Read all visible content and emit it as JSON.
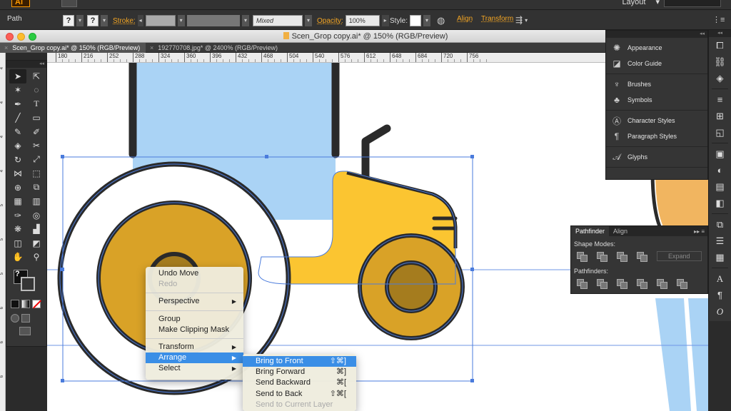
{
  "app": {
    "logo": "Ai",
    "workspace_label": "Layout"
  },
  "control_bar": {
    "selection_label": "Path",
    "stroke_label": "Stroke:",
    "brush_value": "Mixed",
    "opacity_label": "Opacity:",
    "opacity_value": "100%",
    "style_label": "Style:",
    "align_label": "Align",
    "transform_label": "Transform"
  },
  "window": {
    "title": "Scen_Grop copy.ai* @ 150% (RGB/Preview)"
  },
  "tabs": [
    {
      "label": "Scen_Grop copy.ai* @ 150% (RGB/Preview)",
      "active": true
    },
    {
      "label": "192770708.jpg* @ 2400% (RGB/Preview)",
      "active": false
    }
  ],
  "ruler_h": [
    "180",
    "216",
    "252",
    "288",
    "324",
    "360",
    "396",
    "432",
    "468",
    "504",
    "540",
    "576",
    "612",
    "648",
    "684",
    "720",
    "756"
  ],
  "ruler_v": [
    "4",
    "4",
    "4",
    "4",
    "5",
    "5",
    "5",
    "6",
    "6",
    "6"
  ],
  "context_menu": {
    "items": [
      {
        "label": "Undo Move",
        "enabled": true,
        "submenu": false
      },
      {
        "label": "Redo",
        "enabled": false,
        "submenu": false
      },
      {
        "separator": true
      },
      {
        "label": "Perspective",
        "enabled": true,
        "submenu": true
      },
      {
        "separator": true
      },
      {
        "label": "Group",
        "enabled": true,
        "submenu": false
      },
      {
        "label": "Make Clipping Mask",
        "enabled": true,
        "submenu": false
      },
      {
        "separator": true
      },
      {
        "label": "Transform",
        "enabled": true,
        "submenu": true
      },
      {
        "label": "Arrange",
        "enabled": true,
        "submenu": true,
        "highlighted": true
      },
      {
        "label": "Select",
        "enabled": true,
        "submenu": true
      }
    ]
  },
  "arrange_submenu": {
    "items": [
      {
        "label": "Bring to Front",
        "shortcut": "⇧⌘]",
        "highlighted": true
      },
      {
        "label": "Bring Forward",
        "shortcut": "⌘]"
      },
      {
        "label": "Send Backward",
        "shortcut": "⌘["
      },
      {
        "label": "Send to Back",
        "shortcut": "⇧⌘["
      },
      {
        "label": "Send to Current Layer",
        "shortcut": "",
        "disabled": true
      }
    ]
  },
  "panels": {
    "groups": [
      [
        {
          "label": "Appearance",
          "icon": "sun-icon"
        },
        {
          "label": "Color Guide",
          "icon": "color-guide-icon"
        }
      ],
      [
        {
          "label": "Brushes",
          "icon": "brush-icon"
        },
        {
          "label": "Symbols",
          "icon": "club-icon"
        }
      ],
      [
        {
          "label": "Character Styles",
          "icon": "char-style-icon"
        },
        {
          "label": "Paragraph Styles",
          "icon": "para-style-icon"
        }
      ],
      [
        {
          "label": "Glyphs",
          "icon": "glyph-icon"
        }
      ]
    ]
  },
  "pathfinder": {
    "tabs": [
      "Pathfinder",
      "Align"
    ],
    "shape_modes_label": "Shape Modes:",
    "pathfinders_label": "Pathfinders:",
    "expand_label": "Expand"
  },
  "colors": {
    "tractor_yellow": "#fbc531",
    "wheel_gold": "#d9a227",
    "hub_brown": "#a57c1e",
    "cab_blue": "#aad3f5",
    "outline": "#2a2a2a",
    "selection": "#4a7bdc",
    "menu_highlight": "#3a8ee6",
    "accent_orange": "#f5a623"
  }
}
